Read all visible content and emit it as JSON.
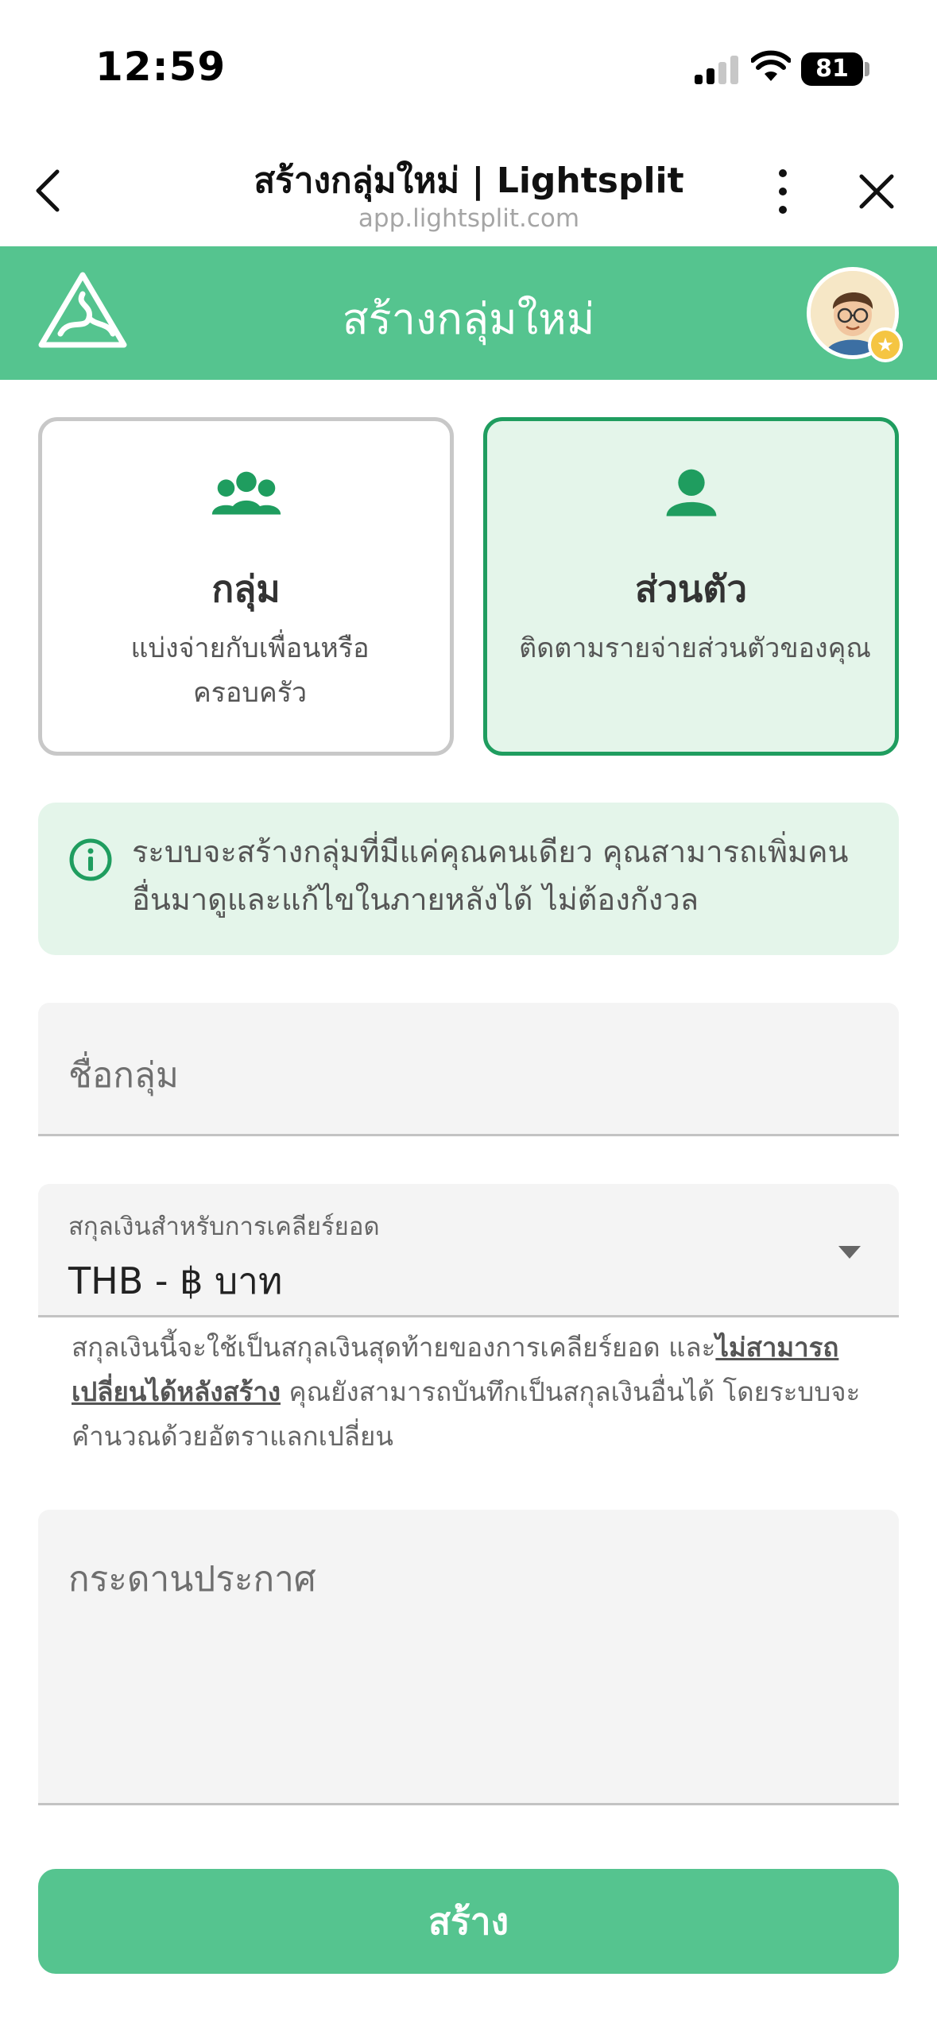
{
  "status_bar": {
    "time": "12:59",
    "battery": "81",
    "icons": [
      "signal-icon",
      "wifi-icon",
      "battery-icon"
    ]
  },
  "browser": {
    "title": "สร้างกลุ่มใหม่ | Lightsplit",
    "url": "app.lightsplit.com",
    "icons": [
      "back-icon",
      "more-icon",
      "close-icon"
    ]
  },
  "header": {
    "title": "สร้างกลุ่มใหม่",
    "logo_icon": "lightsplit-logo-icon",
    "avatar_icon": "user-avatar",
    "badge_icon": "star-badge-icon"
  },
  "modes": {
    "group": {
      "title": "กลุ่ม",
      "description": "แบ่งจ่ายกับเพื่อนหรือครอบครัว",
      "icon": "group-icon",
      "selected": false
    },
    "personal": {
      "title": "ส่วนตัว",
      "description": "ติดตามรายจ่ายส่วนตัวของคุณ",
      "icon": "person-icon",
      "selected": true
    }
  },
  "info": {
    "text": "ระบบจะสร้างกลุ่มที่มีแค่คุณคนเดียว คุณสามารถเพิ่มคนอื่นมาดูและแก้ไขในภายหลังได้ ไม่ต้องกังวล",
    "icon": "info-icon"
  },
  "form": {
    "group_name_placeholder": "ชื่อกลุ่ม",
    "currency_label": "สกุลเงินสำหรับการเคลียร์ยอด",
    "currency_value": "THB - ฿ บาท",
    "currency_help_prefix": "สกุลเงินนี้จะใช้เป็นสกุลเงินสุดท้ายของการเคลียร์ยอด และ",
    "currency_help_strong": "ไม่สามารถเปลี่ยนได้หลังสร้าง",
    "currency_help_suffix": " คุณยังสามารถบันทึกเป็นสกุลเงินอื่นได้ โดยระบบจะคำนวณด้วยอัตราแลกเปลี่ยน",
    "notes_placeholder": "กระดานประกาศ",
    "submit_label": "สร้าง"
  },
  "colors": {
    "brand_green": "#55c48f",
    "selected_border": "#1f9d5f",
    "selected_bg": "#e4f5ea"
  }
}
